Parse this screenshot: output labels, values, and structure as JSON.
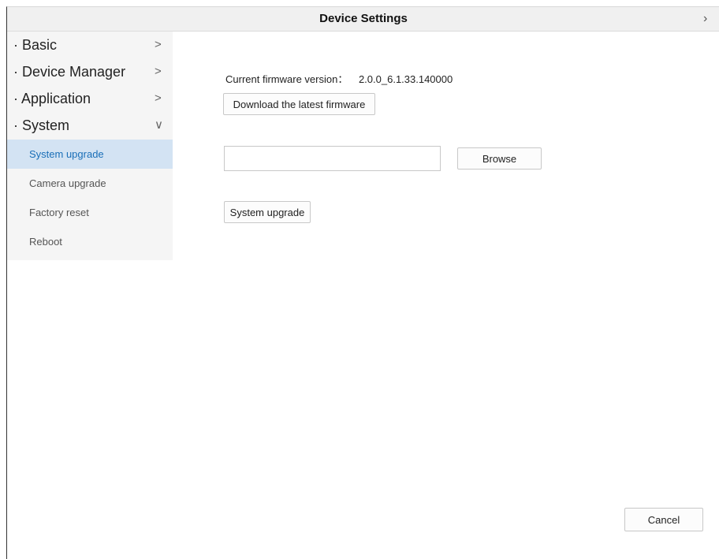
{
  "window": {
    "title": "Device Settings",
    "close_icon": "close-icon",
    "close_glyph": "›"
  },
  "sidebar": {
    "menu": [
      {
        "label": "· Basic",
        "arrow": ">",
        "expanded": false
      },
      {
        "label": "· Device Manager",
        "arrow": ">",
        "expanded": false
      },
      {
        "label": "· Application",
        "arrow": ">",
        "expanded": false
      },
      {
        "label": "· System",
        "arrow": "∨",
        "expanded": true
      }
    ],
    "system_items": [
      {
        "label": "System upgrade",
        "active": true
      },
      {
        "label": "Camera upgrade",
        "active": false
      },
      {
        "label": "Factory reset",
        "active": false
      },
      {
        "label": "Reboot",
        "active": false
      }
    ]
  },
  "main": {
    "firmware_label": "Current firmware version：",
    "firmware_value": "2.0.0_6.1.33.140000",
    "download_button": "Download the latest firmware",
    "file_path_value": "",
    "file_path_placeholder": "",
    "browse_button": "Browse",
    "upgrade_button": "System upgrade",
    "cancel_button": "Cancel"
  },
  "colors": {
    "active_item_bg": "#d3e3f3",
    "active_item_text": "#1a6fb8",
    "sidebar_bg": "#f5f5f5",
    "titlebar_bg": "#f0f0f0"
  }
}
